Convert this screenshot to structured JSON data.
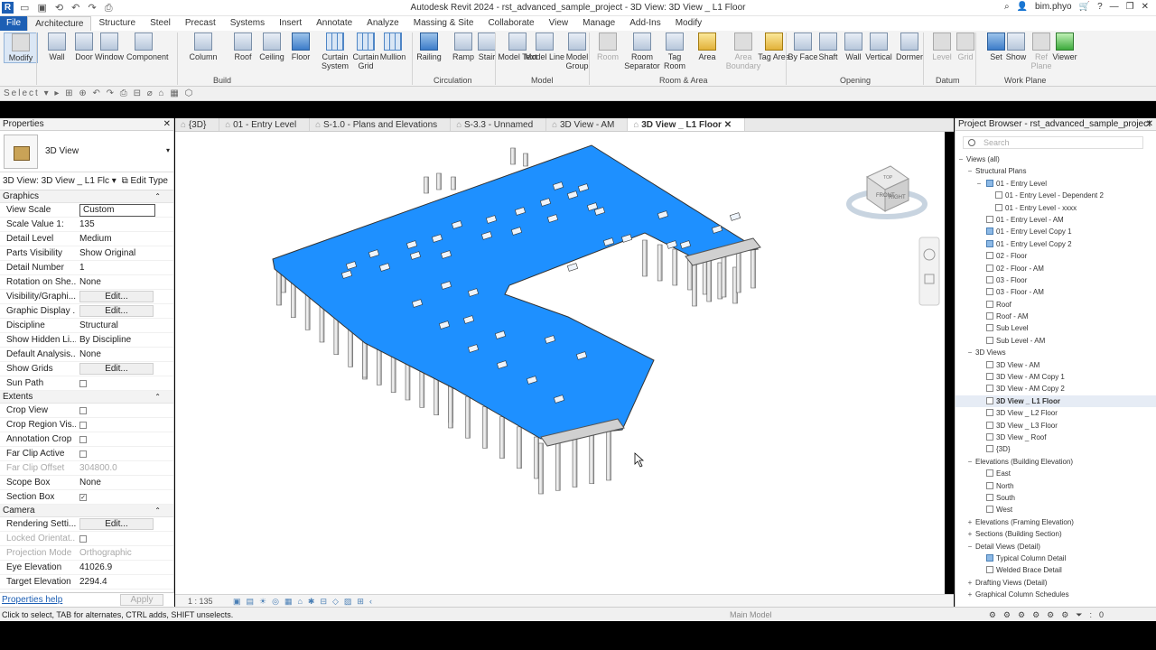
{
  "app": {
    "logo": "R",
    "title": "Autodesk Revit 2024 - rst_advanced_sample_project - 3D View: 3D View _ L1 Floor",
    "user": "bim.phyo",
    "qat_icons": [
      "open-icon",
      "save-icon",
      "sync-icon",
      "undo-icon",
      "redo-icon",
      "print-icon"
    ]
  },
  "menu": {
    "file": "File",
    "tabs": [
      "Architecture",
      "Structure",
      "Steel",
      "Precast",
      "Systems",
      "Insert",
      "Annotate",
      "Analyze",
      "Massing & Site",
      "Collaborate",
      "View",
      "Manage",
      "Add-Ins",
      "Modify"
    ],
    "active": "Architecture"
  },
  "ribbon": {
    "buttons": [
      {
        "label": "Modify",
        "style": "gray",
        "sel": true
      },
      {
        "label": "Wall",
        "style": ""
      },
      {
        "label": "Door",
        "style": ""
      },
      {
        "label": "Window",
        "style": ""
      },
      {
        "label": "Component",
        "style": ""
      },
      {
        "label": "Column",
        "style": ""
      },
      {
        "label": "Roof",
        "style": ""
      },
      {
        "label": "Ceiling",
        "style": ""
      },
      {
        "label": "Floor",
        "style": "blue"
      },
      {
        "label": "Curtain System",
        "style": "grid"
      },
      {
        "label": "Curtain Grid",
        "style": "grid"
      },
      {
        "label": "Mullion",
        "style": "grid"
      },
      {
        "label": "Railing",
        "style": "blue"
      },
      {
        "label": "Ramp",
        "style": ""
      },
      {
        "label": "Stair",
        "style": ""
      },
      {
        "label": "Model Text",
        "style": ""
      },
      {
        "label": "Model Line",
        "style": ""
      },
      {
        "label": "Model Group",
        "style": ""
      },
      {
        "label": "Room",
        "style": "gray"
      },
      {
        "label": "Room Separator",
        "style": ""
      },
      {
        "label": "Tag Room",
        "style": ""
      },
      {
        "label": "Area",
        "style": "yellow"
      },
      {
        "label": "Area Boundary",
        "style": "gray"
      },
      {
        "label": "Tag Area",
        "style": "yellow"
      },
      {
        "label": "By Face",
        "style": ""
      },
      {
        "label": "Shaft",
        "style": ""
      },
      {
        "label": "Wall",
        "style": ""
      },
      {
        "label": "Vertical",
        "style": ""
      },
      {
        "label": "Dormer",
        "style": ""
      },
      {
        "label": "Level",
        "style": "gray"
      },
      {
        "label": "Grid",
        "style": "gray"
      },
      {
        "label": "Set",
        "style": "blue"
      },
      {
        "label": "Show",
        "style": ""
      },
      {
        "label": "Ref Plane",
        "style": "gray"
      },
      {
        "label": "Viewer",
        "style": "green"
      }
    ],
    "panels": [
      "Select",
      "Build",
      "Circulation",
      "Model",
      "Room & Area",
      "Opening",
      "Datum",
      "Work Plane"
    ]
  },
  "properties": {
    "title": "Properties",
    "type_name": "3D View",
    "instance_label": "3D View: 3D View _ L1 Flc",
    "edit_type": "Edit Type",
    "sections": [
      {
        "name": "Graphics",
        "rows": [
          {
            "k": "View Scale",
            "v": "Custom",
            "kind": "box"
          },
          {
            "k": "Scale Value    1:",
            "v": "135"
          },
          {
            "k": "Detail Level",
            "v": "Medium"
          },
          {
            "k": "Parts Visibility",
            "v": "Show Original"
          },
          {
            "k": "Detail Number",
            "v": "1"
          },
          {
            "k": "Rotation on She...",
            "v": "None"
          },
          {
            "k": "Visibility/Graphi...",
            "v": "Edit...",
            "kind": "btn"
          },
          {
            "k": "Graphic Display ...",
            "v": "Edit...",
            "kind": "btn"
          },
          {
            "k": "Discipline",
            "v": "Structural"
          },
          {
            "k": "Show Hidden Li...",
            "v": "By Discipline"
          },
          {
            "k": "Default Analysis...",
            "v": "None"
          },
          {
            "k": "Show Grids",
            "v": "Edit...",
            "kind": "btn"
          },
          {
            "k": "Sun Path",
            "v": "",
            "kind": "cb"
          }
        ]
      },
      {
        "name": "Extents",
        "rows": [
          {
            "k": "Crop View",
            "v": "",
            "kind": "cb"
          },
          {
            "k": "Crop Region Vis...",
            "v": "",
            "kind": "cb"
          },
          {
            "k": "Annotation Crop",
            "v": "",
            "kind": "cb"
          },
          {
            "k": "Far Clip Active",
            "v": "",
            "kind": "cb"
          },
          {
            "k": "Far Clip Offset",
            "v": "304800.0",
            "dis": true
          },
          {
            "k": "Scope Box",
            "v": "None"
          },
          {
            "k": "Section Box",
            "v": "✓",
            "kind": "cb"
          }
        ]
      },
      {
        "name": "Camera",
        "rows": [
          {
            "k": "Rendering Setti...",
            "v": "Edit...",
            "kind": "btn"
          },
          {
            "k": "Locked Orientat...",
            "v": "",
            "kind": "cb",
            "dis": true
          },
          {
            "k": "Projection Mode",
            "v": "Orthographic",
            "dis": true
          },
          {
            "k": "Eye Elevation",
            "v": "41026.9"
          },
          {
            "k": "Target Elevation",
            "v": "2294.4"
          }
        ]
      }
    ],
    "help": "Properties help",
    "apply": "Apply"
  },
  "view_tabs": [
    {
      "label": "{3D}",
      "active": false
    },
    {
      "label": "01 - Entry Level",
      "active": false
    },
    {
      "label": "S-1.0 - Plans and Elevations",
      "active": false
    },
    {
      "label": "S-3.3 - Unnamed",
      "active": false
    },
    {
      "label": "3D View - AM",
      "active": false
    },
    {
      "label": "3D View _ L1 Floor",
      "active": true
    }
  ],
  "viewcube": {
    "front": "FRONT",
    "right": "RIGHT",
    "top": "TOP"
  },
  "view_control": {
    "scale": "1 : 135"
  },
  "browser": {
    "title": "Project Browser - rst_advanced_sample_project",
    "search_placeholder": "Search",
    "items": [
      {
        "t": "Views (all)",
        "lvl": 0,
        "tg": "−"
      },
      {
        "t": "Structural Plans",
        "lvl": 1,
        "tg": "−"
      },
      {
        "t": "01 - Entry Level",
        "lvl": 2,
        "tg": "−",
        "ic": "on"
      },
      {
        "t": "01 - Entry Level - Dependent 2",
        "lvl": 3,
        "ic": "off"
      },
      {
        "t": "01 - Entry Level - xxxx",
        "lvl": 3,
        "ic": "off"
      },
      {
        "t": "01 - Entry Level - AM",
        "lvl": 2,
        "ic": "off"
      },
      {
        "t": "01 - Entry Level Copy 1",
        "lvl": 2,
        "ic": "on"
      },
      {
        "t": "01 - Entry Level Copy 2",
        "lvl": 2,
        "ic": "on"
      },
      {
        "t": "02 - Floor",
        "lvl": 2,
        "ic": "off"
      },
      {
        "t": "02 - Floor - AM",
        "lvl": 2,
        "ic": "off"
      },
      {
        "t": "03 - Floor",
        "lvl": 2,
        "ic": "off"
      },
      {
        "t": "03 - Floor - AM",
        "lvl": 2,
        "ic": "off"
      },
      {
        "t": "Roof",
        "lvl": 2,
        "ic": "off"
      },
      {
        "t": "Roof - AM",
        "lvl": 2,
        "ic": "off"
      },
      {
        "t": "Sub Level",
        "lvl": 2,
        "ic": "off"
      },
      {
        "t": "Sub Level - AM",
        "lvl": 2,
        "ic": "off"
      },
      {
        "t": "3D Views",
        "lvl": 1,
        "tg": "−"
      },
      {
        "t": "3D View - AM",
        "lvl": 2,
        "ic": "off"
      },
      {
        "t": "3D View - AM Copy 1",
        "lvl": 2,
        "ic": "off"
      },
      {
        "t": "3D View - AM Copy 2",
        "lvl": 2,
        "ic": "off"
      },
      {
        "t": "3D View _ L1 Floor",
        "lvl": 2,
        "ic": "off",
        "sel": true
      },
      {
        "t": "3D View _ L2 Floor",
        "lvl": 2,
        "ic": "off"
      },
      {
        "t": "3D View _ L3 Floor",
        "lvl": 2,
        "ic": "off"
      },
      {
        "t": "3D View _ Roof",
        "lvl": 2,
        "ic": "off"
      },
      {
        "t": "{3D}",
        "lvl": 2,
        "ic": "off"
      },
      {
        "t": "Elevations (Building Elevation)",
        "lvl": 1,
        "tg": "−"
      },
      {
        "t": "East",
        "lvl": 2,
        "ic": "off"
      },
      {
        "t": "North",
        "lvl": 2,
        "ic": "off"
      },
      {
        "t": "South",
        "lvl": 2,
        "ic": "off"
      },
      {
        "t": "West",
        "lvl": 2,
        "ic": "off"
      },
      {
        "t": "Elevations (Framing Elevation)",
        "lvl": 1,
        "tg": "+"
      },
      {
        "t": "Sections (Building Section)",
        "lvl": 1,
        "tg": "+"
      },
      {
        "t": "Detail Views (Detail)",
        "lvl": 1,
        "tg": "−"
      },
      {
        "t": "Typical Column Detail",
        "lvl": 2,
        "ic": "on"
      },
      {
        "t": "Welded Brace Detail",
        "lvl": 2,
        "ic": "off"
      },
      {
        "t": "Drafting Views (Detail)",
        "lvl": 1,
        "tg": "+"
      },
      {
        "t": "Graphical Column Schedules",
        "lvl": 1,
        "tg": "+"
      }
    ]
  },
  "status": {
    "hint": "Click to select, TAB for alternates, CTRL adds, SHIFT unselects.",
    "workset": "Main Model",
    "filter": ":0"
  },
  "colors": {
    "floor": "#1e90ff",
    "accent": "#1d5fb4"
  }
}
